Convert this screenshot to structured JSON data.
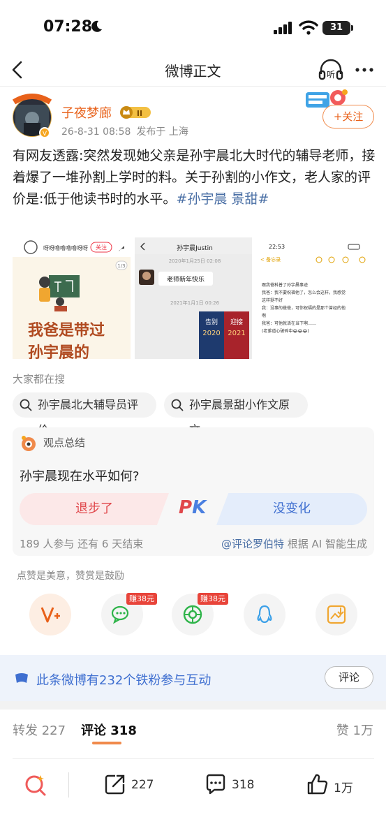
{
  "status_bar": {
    "time": "07:28",
    "battery": "31"
  },
  "nav": {
    "title": "微博正文"
  },
  "post": {
    "author": "子夜梦廊",
    "vip_level": "II",
    "date": "26-8-31 08:58",
    "location": "发布于 上海",
    "follow_label": "+关注",
    "text": "有网友透露:突然发现她父亲是孙宇晨北大时代的辅导老师，接着爆了一堆孙割上学时的料。关于孙割的小作文，老人家的评价是:低于他读书时的水平。",
    "hashtag": "#孙宇晨 景甜#"
  },
  "images": {
    "img1": {
      "top_text": "呀呀噜噜噜噜呀呀",
      "follow": "关注",
      "counter": "1/3",
      "big_text_1": "我爸是带过",
      "big_text_2": "孙宇晨的"
    },
    "img2": {
      "chat_title": "孙宇晨Justin",
      "date1": "2020年1月25日 02:08",
      "message": "老师新年快乐",
      "date2": "2021年1月1日 00:26",
      "card_left_top": "告别",
      "card_left_year": "2020",
      "card_right_top": "迎接",
      "card_right_year": "2021"
    },
    "img3": {
      "time": "22:53",
      "back": "< 备忘录",
      "lines": [
        "跟我爸科普了孙宇晨事迹",
        "我爸：我不要祝福他了，怎么会这样，我感觉",
        "这样挺不好",
        "我：没事的爸爸，可你祝福的是那个曾经的他",
        "啊",
        "我爸：可他就活在当下啊……",
        "(老爹道心破碎中😂😂😂)"
      ]
    }
  },
  "searching": {
    "label": "大家都在搜",
    "chips": [
      "孙宇晨北大辅导员评价",
      "孙宇晨景甜小作文原文"
    ]
  },
  "opinion": {
    "title": "观点总结",
    "question": "孙宇晨现在水平如何?",
    "left_option": "退步了",
    "pk_p": "P",
    "pk_k": "K",
    "right_option": "没变化",
    "stats": "189 人参与   还有 6 天结束",
    "source_account": "@评论罗伯特",
    "source_suffix": " 根据 AI 智能生成"
  },
  "reward": {
    "label": "点赞是美意，赞赏是鼓励",
    "earn_1": "赚38元",
    "earn_2": "赚38元"
  },
  "fans": {
    "text": "此条微博有232个铁粉参与互动",
    "button": "评论"
  },
  "tabs": {
    "repost": "转发 227",
    "comment": "评论 318",
    "like": "赞 1万"
  },
  "bottom_bar": {
    "repost_count": "227",
    "comment_count": "318",
    "like_count": "1万"
  },
  "colors": {
    "accent": "#e8611a",
    "link": "#4a6fa5",
    "pk_red": "#e0474b",
    "pk_blue": "#3f6fd0"
  }
}
